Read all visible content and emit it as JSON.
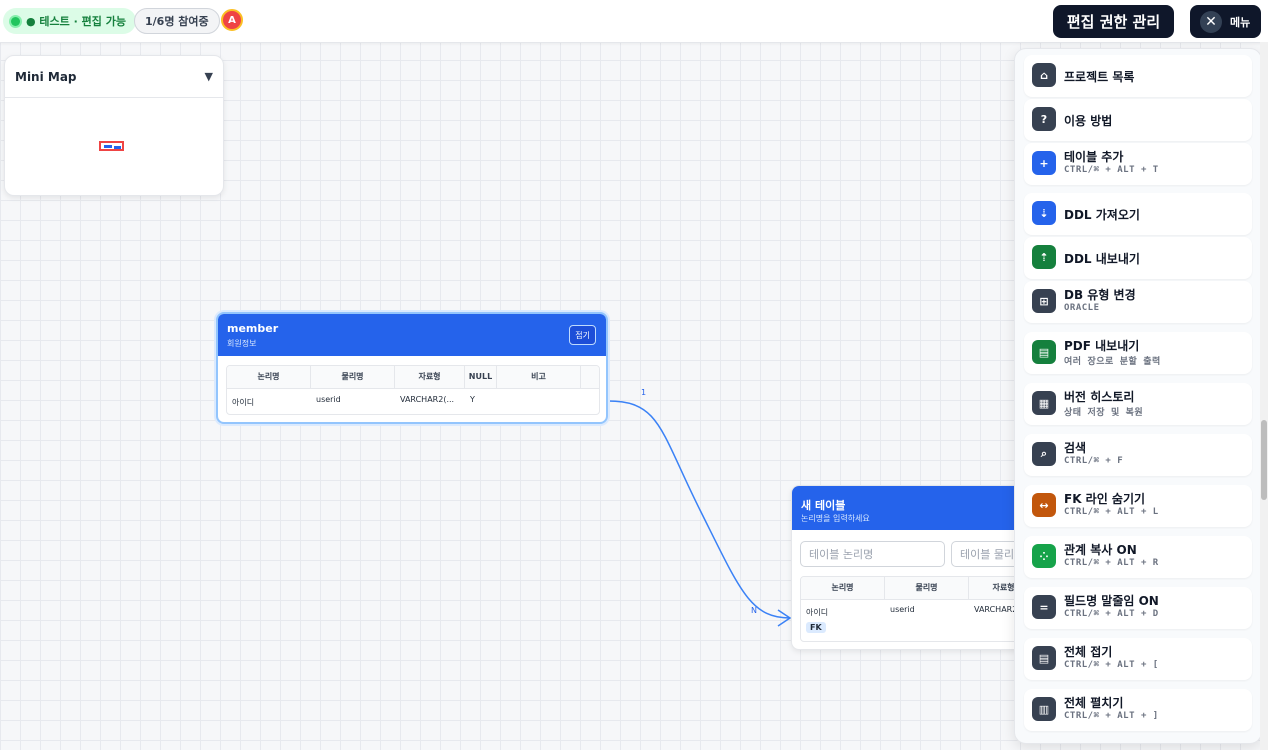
{
  "header": {
    "status_label": "● 테스트 · 편집 가능",
    "participants": "1/6명 참여중",
    "avatar_initial": "A",
    "edit_permission_button": "편집 권한 관리",
    "menu_button": "메뉴",
    "close_icon": "✕"
  },
  "minimap": {
    "title": "Mini Map",
    "toggle_icon": "▼"
  },
  "member_table": {
    "title": "member",
    "subtitle": "회원정보",
    "fold_button": "접기",
    "columns": [
      "논리명",
      "물리명",
      "자료형",
      "NULL",
      "비고"
    ],
    "rows": [
      {
        "logical": "아이디",
        "physical": "userid",
        "type": "VARCHAR2(...",
        "null": "Y",
        "note": ""
      }
    ]
  },
  "relation": {
    "start_label": "1",
    "end_label": "N"
  },
  "new_table": {
    "title": "새 테이블",
    "subtitle": "논리명을 입력하세요",
    "logical_placeholder": "테이블 논리명",
    "physical_placeholder": "테이블 물리명",
    "columns": [
      "논리명",
      "물리명",
      "자료형"
    ],
    "rows": [
      {
        "logical": "아이디",
        "physical": "userid",
        "type": "VARCHAR2",
        "badge": "FK"
      }
    ]
  },
  "menu": {
    "items": [
      {
        "icon": "home-icon",
        "glyph": "⌂",
        "color": "#374151",
        "label": "프로젝트 목록",
        "shortcut": ""
      },
      {
        "icon": "help-icon",
        "glyph": "?",
        "color": "#374151",
        "label": "이용 방법",
        "shortcut": ""
      },
      {
        "icon": "plus-icon",
        "glyph": "+",
        "color": "#2563eb",
        "label": "테이블 추가",
        "shortcut": "CTRL/⌘ + ALT + T"
      },
      {
        "icon": "import-icon",
        "glyph": "⇣",
        "color": "#2563eb",
        "label": "DDL 가져오기",
        "shortcut": ""
      },
      {
        "icon": "export-icon",
        "glyph": "⇡",
        "color": "#15803d",
        "label": "DDL 내보내기",
        "shortcut": ""
      },
      {
        "icon": "database-icon",
        "glyph": "⊞",
        "color": "#374151",
        "label": "DB 유형 변경",
        "shortcut": "ORACLE"
      },
      {
        "icon": "pdf-icon",
        "glyph": "▤",
        "color": "#15803d",
        "label": "PDF 내보내기",
        "shortcut": "여러 장으로 분할 출력"
      },
      {
        "icon": "history-icon",
        "glyph": "▦",
        "color": "#374151",
        "label": "버전 히스토리",
        "shortcut": "상태 저장 및 복원"
      },
      {
        "icon": "search-icon",
        "glyph": "⌕",
        "color": "#374151",
        "label": "검색",
        "shortcut": "CTRL/⌘ + F"
      },
      {
        "icon": "fk-line-icon",
        "glyph": "↔",
        "color": "#c2570c",
        "label": "FK 라인 숨기기",
        "shortcut": "CTRL/⌘ + ALT + L"
      },
      {
        "icon": "relation-copy-icon",
        "glyph": "⁘",
        "color": "#16a34a",
        "label": "관계 복사 ON",
        "shortcut": "CTRL/⌘ + ALT + R"
      },
      {
        "icon": "ellipsis-icon",
        "glyph": "=",
        "color": "#374151",
        "label": "필드명 말줄임 ON",
        "shortcut": "CTRL/⌘ + ALT + D"
      },
      {
        "icon": "collapse-all-icon",
        "glyph": "▤",
        "color": "#374151",
        "label": "전체 접기",
        "shortcut": "CTRL/⌘ + ALT + ["
      },
      {
        "icon": "expand-all-icon",
        "glyph": "▥",
        "color": "#374151",
        "label": "전체 펼치기",
        "shortcut": "CTRL/⌘ + ALT + ]"
      }
    ]
  }
}
